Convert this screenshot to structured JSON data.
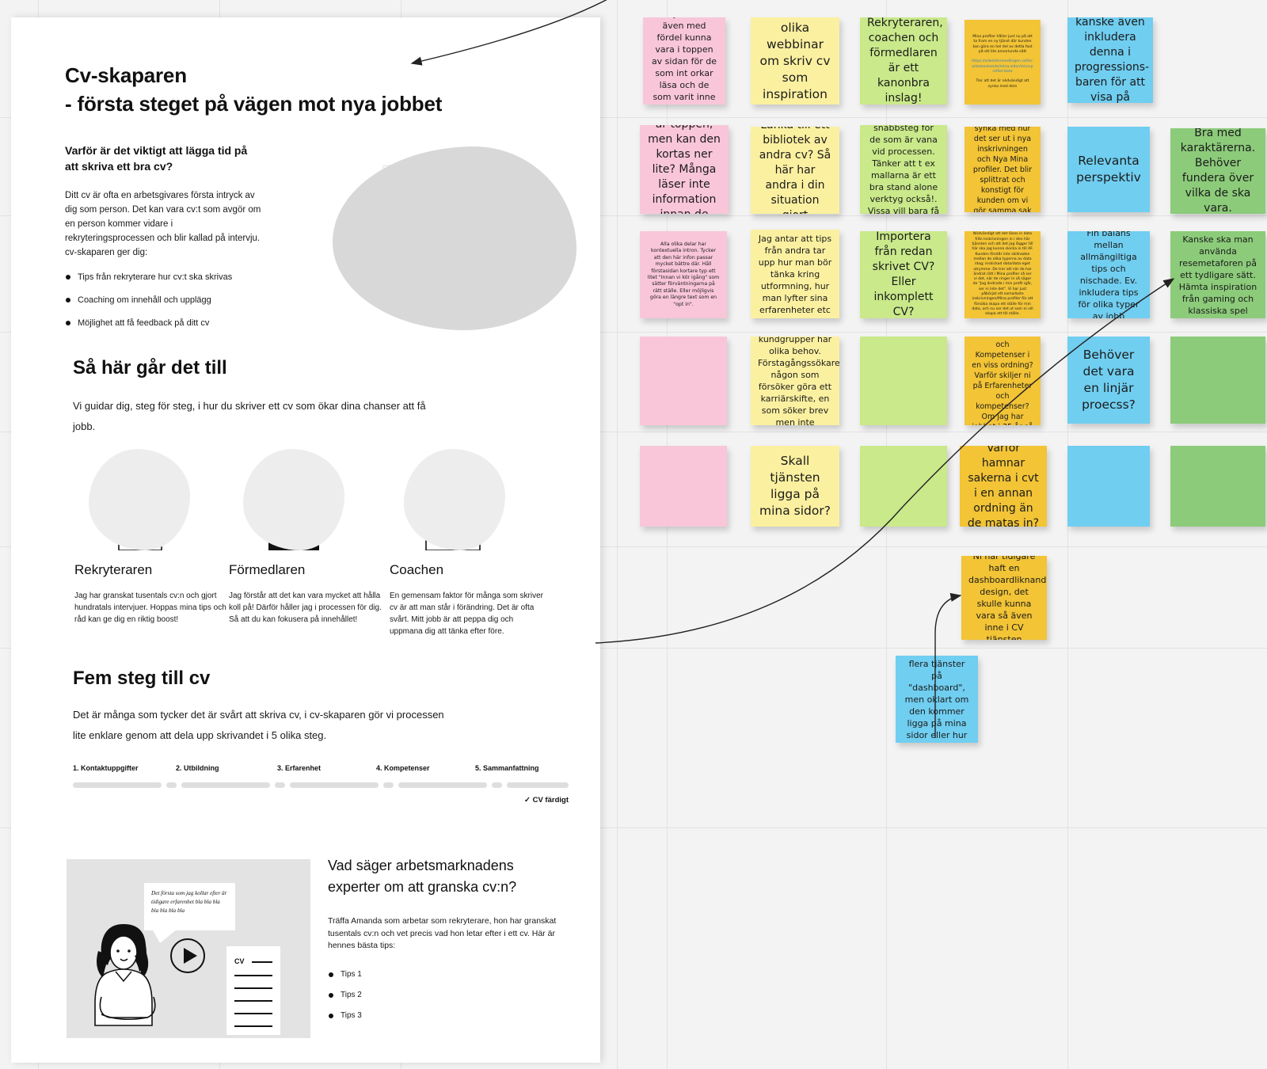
{
  "document": {
    "title": "Cv-skaparen",
    "subtitle": "- första steget på vägen mot nya jobbet",
    "intro": {
      "heading": "Varför är det viktigt att lägga tid på att skriva ett bra cv?",
      "paragraph": "Ditt cv är ofta en arbetsgivares första intryck av dig som person. Det kan vara cv:t som avgör om en person kommer vidare i rekryteringsprocessen och blir kallad på intervju. cv-skaparen ger dig:",
      "bullets": [
        "Tips från rekryterare hur cv:t ska skrivas",
        "Coaching om innehåll och upplägg",
        "Möjlighet att få feedback på ditt cv"
      ],
      "illustration_label": "CV"
    },
    "how_it_works": {
      "heading": "Så här går det till",
      "paragraph": "Vi guidar dig, steg för steg, i hur du skriver ett cv som ökar dina chanser att få jobb.",
      "personas": [
        {
          "name": "Rekryteraren",
          "text": "Jag har granskat tusentals cv:n och gjort hundratals intervjuer. Hoppas mina tips och råd kan ge dig en riktig boost!"
        },
        {
          "name": "Förmedlaren",
          "text": "Jag förstår att det kan vara mycket att hålla koll på! Därför håller jag i processen för dig. Så att du kan fokusera på innehållet!"
        },
        {
          "name": "Coachen",
          "text": "En gemensam faktor för många som skriver cv är att man står i förändring. Det är ofta svårt. Mitt jobb är att peppa dig och uppmana dig att tänka efter före."
        }
      ]
    },
    "five_steps": {
      "heading": "Fem steg till cv",
      "paragraph": "Det är många som tycker det är svårt att skriva cv, i cv-skaparen gör vi processen lite enklare genom att dela upp skrivandet i 5 olika steg.",
      "steps": [
        "1. Kontaktuppgifter",
        "2. Utbildning",
        "3. Erfarenhet",
        "4. Kompetenser",
        "5. Sammanfattning"
      ],
      "done_label": "✓ CV färdigt"
    },
    "video_section": {
      "heading": "Vad säger arbetsmarknadens experter om att granska cv:n?",
      "paragraph": "Träffa Amanda som arbetar som rekryterare, hon har granskat tusentals cv:n och vet precis vad hon letar efter i ett cv. Här är hennes bästa tips:",
      "tips": [
        "Tips 1",
        "Tips 2",
        "Tips 3"
      ],
      "speech_bubble": "Det första som jag kollar efter är tidigare erfarenhet bla bla bla bla bla bla bla",
      "cv_label": "CV",
      "play_icon": "play-icon"
    }
  },
  "board": {
    "colors": {
      "pink": "#f9c6d9",
      "yellow": "#fbf0a0",
      "lime": "#c9e98a",
      "gold": "#f2c436",
      "blue": "#70cef0",
      "green": "#8ccb7a"
    },
    "notes": [
      {
        "color": "pink",
        "size": "t-md",
        "text": "Länken till att börja skulle även med fördel kunna vara i toppen av sidan för de som int orkar läsa och de som varit inne tidigare - slippa scrolla"
      },
      {
        "color": "yellow",
        "size": "t-xl",
        "text": "Länka till olika webbinar om skriv cv som inspiration och hjälp?"
      },
      {
        "color": "lime",
        "size": "t-lg",
        "text": "Rekryteraren, coachen och förmedlaren är ett kanonbra inslag!"
      },
      {
        "color": "gold",
        "size": "t-xxs",
        "text": "Mina profiler håller just nu på att ta fram en ny tjänst där kunden kan göra en hel del av detta fast på ett lite annorlunda sätt",
        "link": "https://arbetsformedlingen.se/for-arbetssokande/mina-sidor/mina-profiler-beta",
        "text2": "Tror att det är nödvändigt att synka med dem"
      },
      {
        "color": "blue",
        "size": "t-lg",
        "text": "Bra med Intro - kanske även inkludera denna i progressions-baren för att visa på efterföljande steg"
      },
      {
        "color": "pink",
        "size": "t-lg",
        "text": "Informationen är toppen, men kan den kortas ner lite? Många läser inte information innan de börjar..."
      },
      {
        "color": "yellow",
        "size": "t-lg",
        "text": "Länka till ett bibliotek av andra cv? Så här har andra i din situation gjort"
      },
      {
        "color": "lime",
        "size": "t-md",
        "text": "Införa något snabbsteg för de som är vana vid processen. Tänker att t ex mallarna är ett bra stand alone verktyg också!. Vissa vill bara få det överstökat."
      },
      {
        "color": "gold",
        "size": "t-sm",
        "text": "Nödvändigt att synka med hur det ser ut i nya inskrivningen och Nya Mina profiler. Det blir splittrat och konstigt för kunden om vi gör samma sak på olika sätt"
      },
      {
        "color": "blue",
        "size": "t-xl",
        "text": "Relevanta perspektiv"
      },
      {
        "color": "green",
        "size": "t-lg",
        "text": "Bra med karaktärerna. Behöver fundera över vilka de ska vara."
      },
      {
        "color": "pink",
        "size": "t-xs",
        "text": "Alla olika delar har kontextuella intron. Tycker att den här infon passar mycket bättre där. Håll förstasidan kortare typ ett litet \"Innan vi kör igång\" som sätter förväntningarna på rätt ställe. Eller möjligvis göra en längre text som en \"opt in\"."
      },
      {
        "color": "yellow",
        "size": "t-md",
        "text": "Jag antar att tips från andra tar upp hur man bör tänka kring utformning, hur man lyfter sina erfarenheter etc"
      },
      {
        "color": "lime",
        "size": "t-lg",
        "text": "Importera från redan skrivet CV? Eller inkomplett CV?"
      },
      {
        "color": "gold",
        "size": "t-xxs",
        "text": "Nödvändigt att det läses in data från inskrivningen in i den här tjänsten och att det jag lägger till här ska jag kunna skicka in till AF. Kunden förstår inte skillnaden mellan de olika typerna av data idag; inskickad data/data eget utrymme. De tror att när de har ändrat rätt i Mina profiler så ser vi det, när de ringer in så säger de \"Jag ändrade i min profil igår, ser ni inte det\". Vi har just påbörjat ett samarbete inskrivningen/Mina profiler för att försöka skapa ett ställe för min data, och nu ser det ut som ni vill skapa ett till ställe."
      },
      {
        "color": "blue",
        "size": "t-md",
        "text": "Fin balans mellan allmängiltiga tips och nischade. Ev. inkludera tips för olika typer av jobb"
      },
      {
        "color": "green",
        "size": "t-md",
        "text": "Kanske ska man använda resemetaforen på ett tydligare sätt. Hämta inspiration från gaming och klassiska spel"
      },
      {
        "color": "pink",
        "size": "t-md",
        "text": ""
      },
      {
        "color": "yellow",
        "size": "t-md",
        "text": "Olika kundgrupper har olika behov. Förstagångssökaren, någon som försöker göra ett karriärskifte, en som söker brev men inte kommer framåt.."
      },
      {
        "color": "lime",
        "size": "t-md",
        "text": ""
      },
      {
        "color": "gold",
        "size": "t-sm",
        "text": "Varför måste man matat in Utbildning, erfarenheter och Kompetenser i en viss ordning? Varför skiljer ni på Erfarenheter och kompetenser? Om jag har jobbat i 35 år så är min gymnasieutbildning irrelevant"
      },
      {
        "color": "blue",
        "size": "t-xl",
        "text": "Behöver det vara en linjär proecss?"
      },
      {
        "color": "green",
        "size": "t-md",
        "text": ""
      },
      {
        "color": "pink",
        "size": "t-md",
        "text": ""
      },
      {
        "color": "yellow",
        "size": "t-xl",
        "text": "Skall tjänsten ligga på mina sidor?"
      },
      {
        "color": "lime",
        "size": "t-md",
        "text": ""
      },
      {
        "color": "gold",
        "size": "t-lg",
        "text": "Varför hamnar sakerna i cvt i en annan ordning än de matas in?"
      },
      {
        "color": "blue",
        "size": "t-md",
        "text": ""
      },
      {
        "color": "green",
        "size": "t-md",
        "text": ""
      },
      {
        "color": "gold",
        "size": "t-md",
        "text": "Ni har tidigare haft en dashboardliknande design, det skulle kunna vara så även inne i CV tjänsten"
      },
      {
        "color": "blue",
        "size": "t-md",
        "text": "Detta är en av flera tjänster på \"dashboard\", men oklart om den kommer ligga på mina sidor eller hur det blir..."
      }
    ]
  }
}
